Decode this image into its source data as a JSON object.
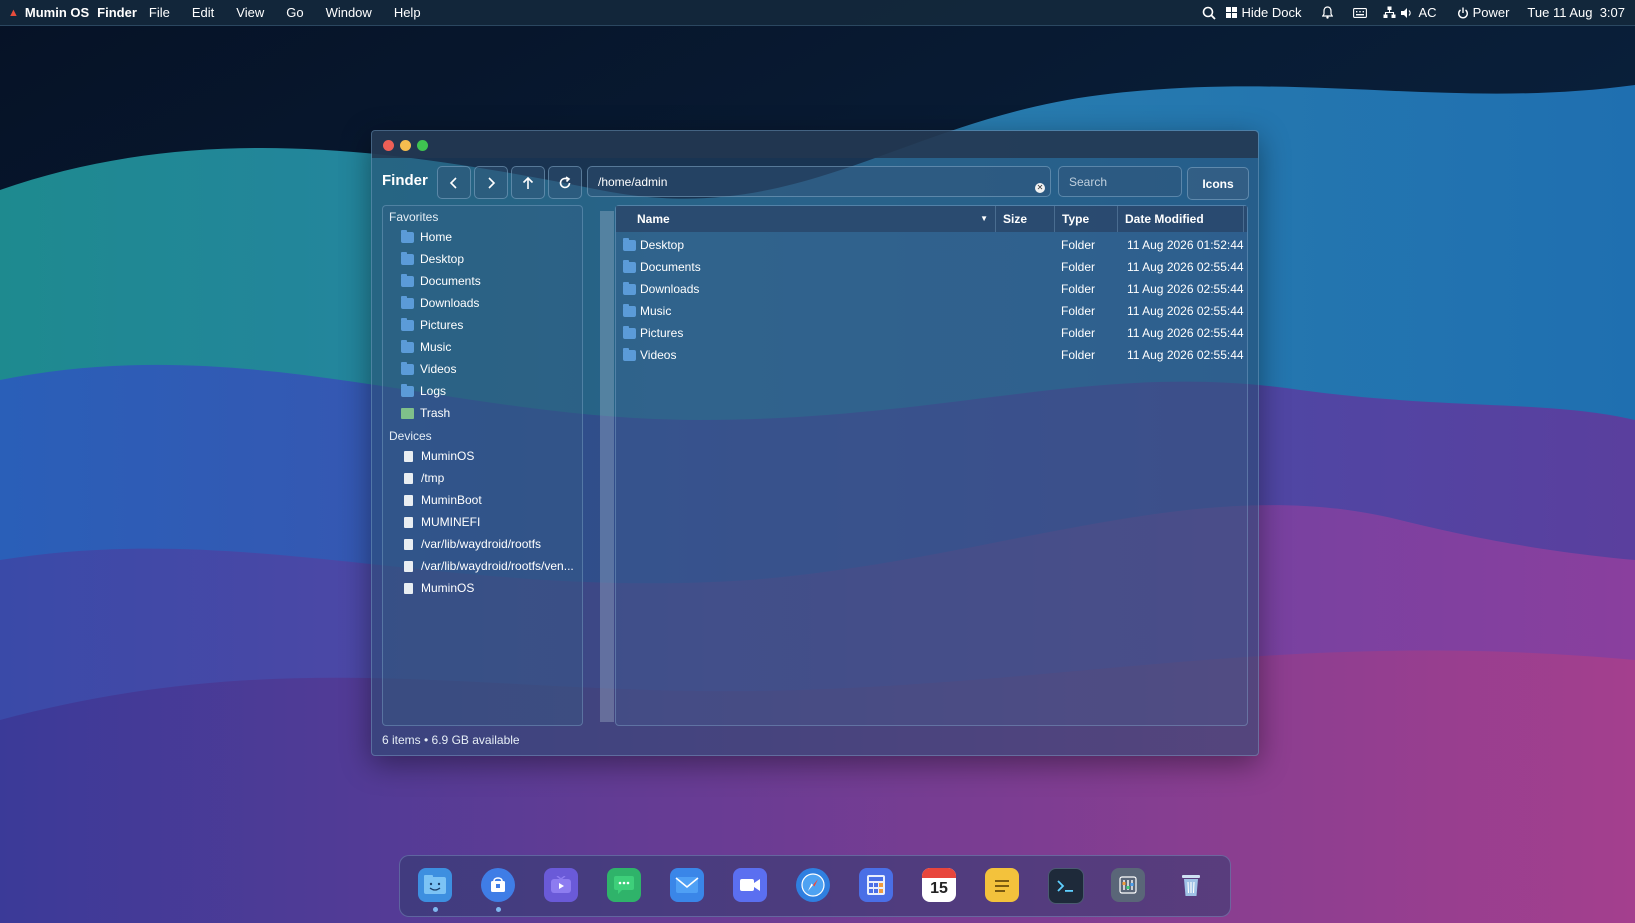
{
  "menubar": {
    "os_name": "Mumin OS",
    "app_name": "Finder",
    "menus": [
      "File",
      "Edit",
      "View",
      "Go",
      "Window",
      "Help"
    ],
    "hide_dock": "Hide Dock",
    "power_source": "AC",
    "power": "Power",
    "clock": "Tue 11 Aug  3:07"
  },
  "finder": {
    "title": "Finder",
    "path": "/home/admin",
    "search_placeholder": "Search",
    "view_button": "Icons",
    "sidebar": {
      "favorites_label": "Favorites",
      "favorites": [
        {
          "label": "Home",
          "icon": "folder-icon"
        },
        {
          "label": "Desktop",
          "icon": "folder-icon"
        },
        {
          "label": "Documents",
          "icon": "folder-icon"
        },
        {
          "label": "Downloads",
          "icon": "folder-icon"
        },
        {
          "label": "Pictures",
          "icon": "folder-icon"
        },
        {
          "label": "Music",
          "icon": "folder-icon"
        },
        {
          "label": "Videos",
          "icon": "folder-icon"
        },
        {
          "label": "Logs",
          "icon": "folder-icon"
        },
        {
          "label": "Trash",
          "icon": "trash-icon"
        }
      ],
      "devices_label": "Devices",
      "devices": [
        {
          "label": "MuminOS"
        },
        {
          "label": "/tmp"
        },
        {
          "label": "MuminBoot"
        },
        {
          "label": "MUMINEFI"
        },
        {
          "label": "/var/lib/waydroid/rootfs"
        },
        {
          "label": "/var/lib/waydroid/rootfs/ven..."
        },
        {
          "label": "MuminOS"
        }
      ]
    },
    "columns": {
      "name": "Name",
      "size": "Size",
      "type": "Type",
      "date": "Date Modified"
    },
    "files": [
      {
        "name": "Desktop",
        "size": "",
        "type": "Folder",
        "date": "11 Aug 2026 01:52:44"
      },
      {
        "name": "Documents",
        "size": "",
        "type": "Folder",
        "date": "11 Aug 2026 02:55:44"
      },
      {
        "name": "Downloads",
        "size": "",
        "type": "Folder",
        "date": "11 Aug 2026 02:55:44"
      },
      {
        "name": "Music",
        "size": "",
        "type": "Folder",
        "date": "11 Aug 2026 02:55:44"
      },
      {
        "name": "Pictures",
        "size": "",
        "type": "Folder",
        "date": "11 Aug 2026 02:55:44"
      },
      {
        "name": "Videos",
        "size": "",
        "type": "Folder",
        "date": "11 Aug 2026 02:55:44"
      }
    ],
    "status": "6 items • 6.9 GB available"
  },
  "dock": {
    "calendar_day": "15",
    "apps": [
      {
        "name": "finder-icon",
        "color": "#3d8fe0"
      },
      {
        "name": "store-icon",
        "color": "#3f7de6"
      },
      {
        "name": "tv-icon",
        "color": "#6a5ad8"
      },
      {
        "name": "messages-icon",
        "color": "#2fb36a"
      },
      {
        "name": "mail-icon",
        "color": "#3a86e8"
      },
      {
        "name": "video-call-icon",
        "color": "#5b6ff0"
      },
      {
        "name": "browser-icon",
        "color": "#2f7fe0"
      },
      {
        "name": "calculator-icon",
        "color": "#4a6fe6"
      },
      {
        "name": "calendar-icon",
        "color": "#e8453c"
      },
      {
        "name": "notes-icon",
        "color": "#f3c23c"
      },
      {
        "name": "terminal-icon",
        "color": "#1e2a3a"
      },
      {
        "name": "settings-icon",
        "color": "#5a6678"
      },
      {
        "name": "trash-icon",
        "color": "#8fb0d8"
      }
    ]
  }
}
